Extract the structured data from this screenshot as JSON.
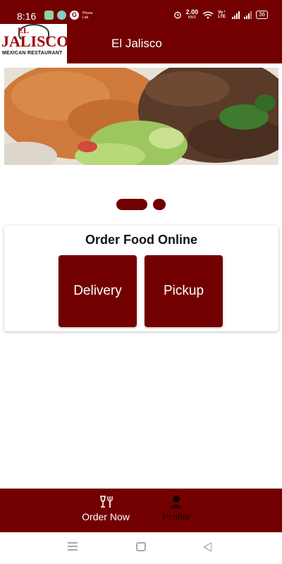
{
  "status_bar": {
    "time": "8:16",
    "tiny_label": "Phone Lab",
    "net_speed": "2.00",
    "net_unit": "KB/S",
    "volte": "Vo ᵗ LTE",
    "battery": "36",
    "icons": [
      "message-icon",
      "bubble-icon",
      "google-icon",
      "alarm-icon",
      "wifi-icon",
      "signal-icon",
      "battery-icon"
    ]
  },
  "app_bar": {
    "title": "El Jalisco",
    "logo": {
      "top_text": "EL",
      "main_text": "JALISCO",
      "sub_text": "MEXICAN RESTAURANT"
    }
  },
  "hero": {
    "icon": "food-photo",
    "colors": {
      "rice": "#cf7a3c",
      "meat": "#5a3a28",
      "pepper": "#3f7a2e",
      "lettuce": "#9cc760",
      "plate": "#e7e0d6"
    }
  },
  "carousel": {
    "active_index": 0,
    "count": 2
  },
  "order_card": {
    "title": "Order Food Online",
    "options": [
      {
        "label": "Delivery"
      },
      {
        "label": "Pickup"
      }
    ]
  },
  "bottom_nav": {
    "items": [
      {
        "label": "Order Now",
        "icon": "fork-knife-icon",
        "active": true
      },
      {
        "label": "Profile",
        "icon": "person-icon",
        "active": false
      }
    ]
  },
  "colors": {
    "brand": "#720000",
    "white": "#ffffff"
  }
}
